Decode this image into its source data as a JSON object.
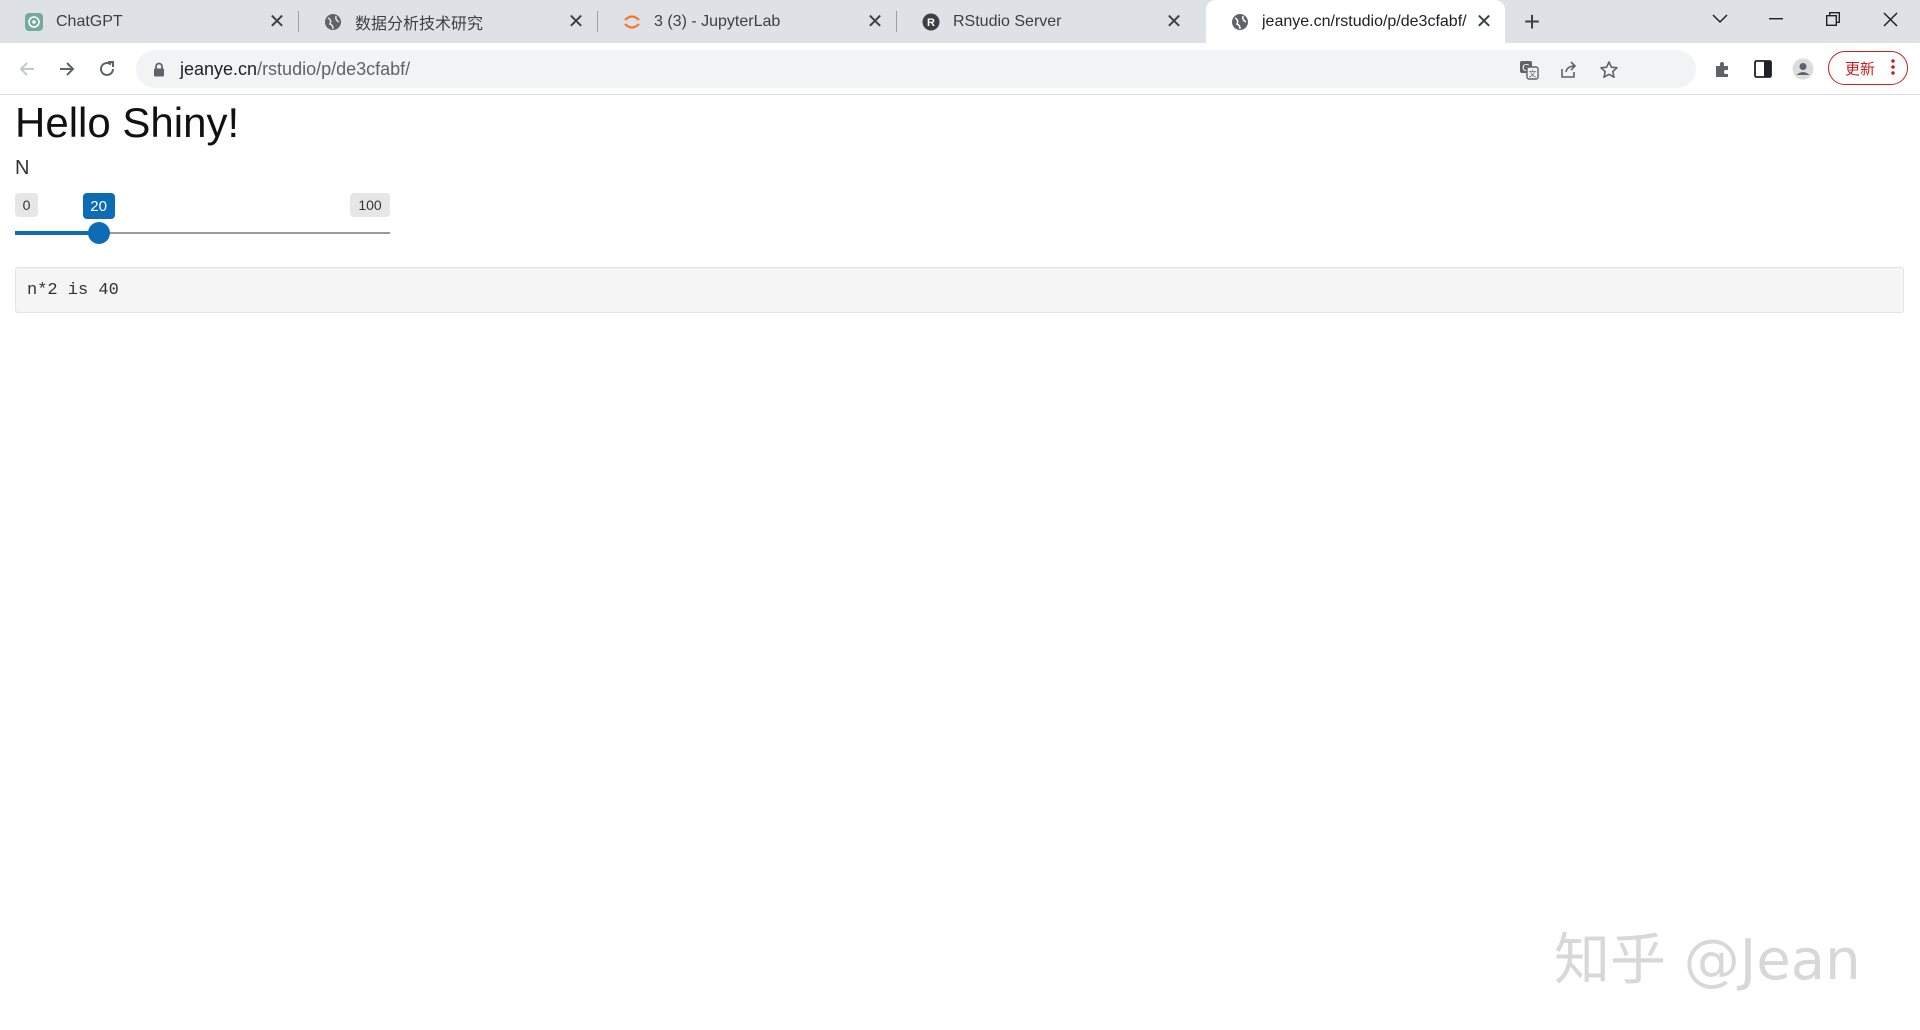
{
  "browser": {
    "tabs": [
      {
        "title": "ChatGPT",
        "icon": "chatgpt-icon"
      },
      {
        "title": "数据分析技术研究",
        "icon": "globe-icon"
      },
      {
        "title": "3 (3) - JupyterLab",
        "icon": "jupyter-icon"
      },
      {
        "title": "RStudio Server",
        "icon": "rstudio-icon"
      },
      {
        "title": "jeanye.cn/rstudio/p/de3cfabf/",
        "icon": "globe-icon",
        "active": true
      }
    ],
    "address": {
      "host": "jeanye.cn",
      "path": "/rstudio/p/de3cfabf/"
    },
    "update_label": "更新",
    "accent_color": "#c5221f"
  },
  "page": {
    "title": "Hello Shiny!",
    "slider": {
      "label": "N",
      "min": "0",
      "max": "100",
      "value": "20",
      "fraction": 0.2,
      "color": "#0d6cb5"
    },
    "output_text": "n*2 is 40"
  },
  "watermark": "知乎 @Jean"
}
